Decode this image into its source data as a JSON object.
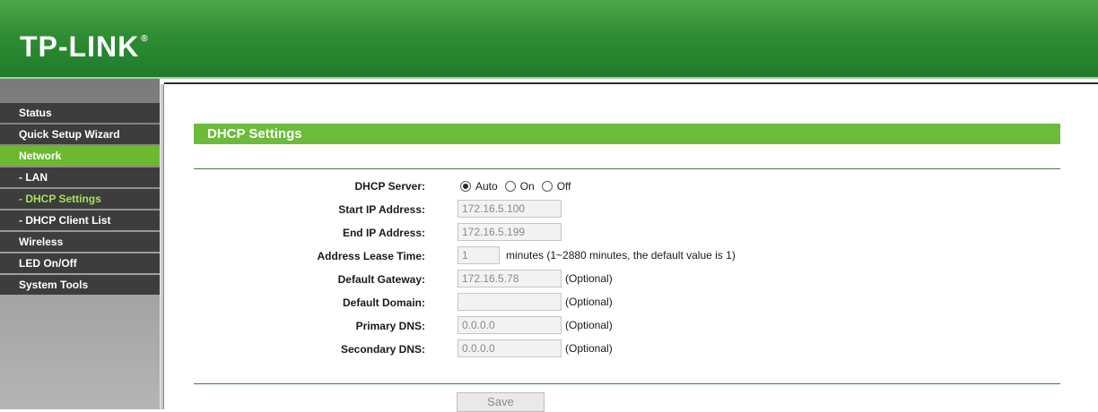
{
  "header": {
    "logo_text": "TP-LINK",
    "logo_mark": "®"
  },
  "sidebar": {
    "items": [
      {
        "label": "Status"
      },
      {
        "label": "Quick Setup Wizard"
      },
      {
        "label": "Network"
      },
      {
        "label": "- LAN"
      },
      {
        "label": "- DHCP Settings"
      },
      {
        "label": "- DHCP Client List"
      },
      {
        "label": "Wireless"
      },
      {
        "label": "LED On/Off"
      },
      {
        "label": "System Tools"
      }
    ],
    "active_item": "Network",
    "selected_subitem": "- DHCP Settings"
  },
  "main": {
    "section_title": "DHCP Settings",
    "dhcp_server": {
      "label": "DHCP Server:",
      "options": [
        "Auto",
        "On",
        "Off"
      ],
      "selected": "Auto"
    },
    "start_ip": {
      "label": "Start IP Address:",
      "value": "172.16.5.100"
    },
    "end_ip": {
      "label": "End IP Address:",
      "value": "172.16.5.199"
    },
    "lease_time": {
      "label": "Address Lease Time:",
      "value": "1",
      "hint": "minutes (1~2880 minutes, the default value is 1)"
    },
    "default_gateway": {
      "label": "Default Gateway:",
      "value": "172.16.5.78",
      "hint": "(Optional)"
    },
    "default_domain": {
      "label": "Default Domain:",
      "value": "",
      "hint": "(Optional)"
    },
    "primary_dns": {
      "label": "Primary DNS:",
      "value": "0.0.0.0",
      "hint": "(Optional)"
    },
    "secondary_dns": {
      "label": "Secondary DNS:",
      "value": "0.0.0.0",
      "hint": "(Optional)"
    },
    "save_label": "Save"
  },
  "colors": {
    "header_green": "#2e8d33",
    "accent_green": "#6cbb3c",
    "menu_dark": "#3d3d3d",
    "subitem_highlight": "#a6e05a"
  }
}
